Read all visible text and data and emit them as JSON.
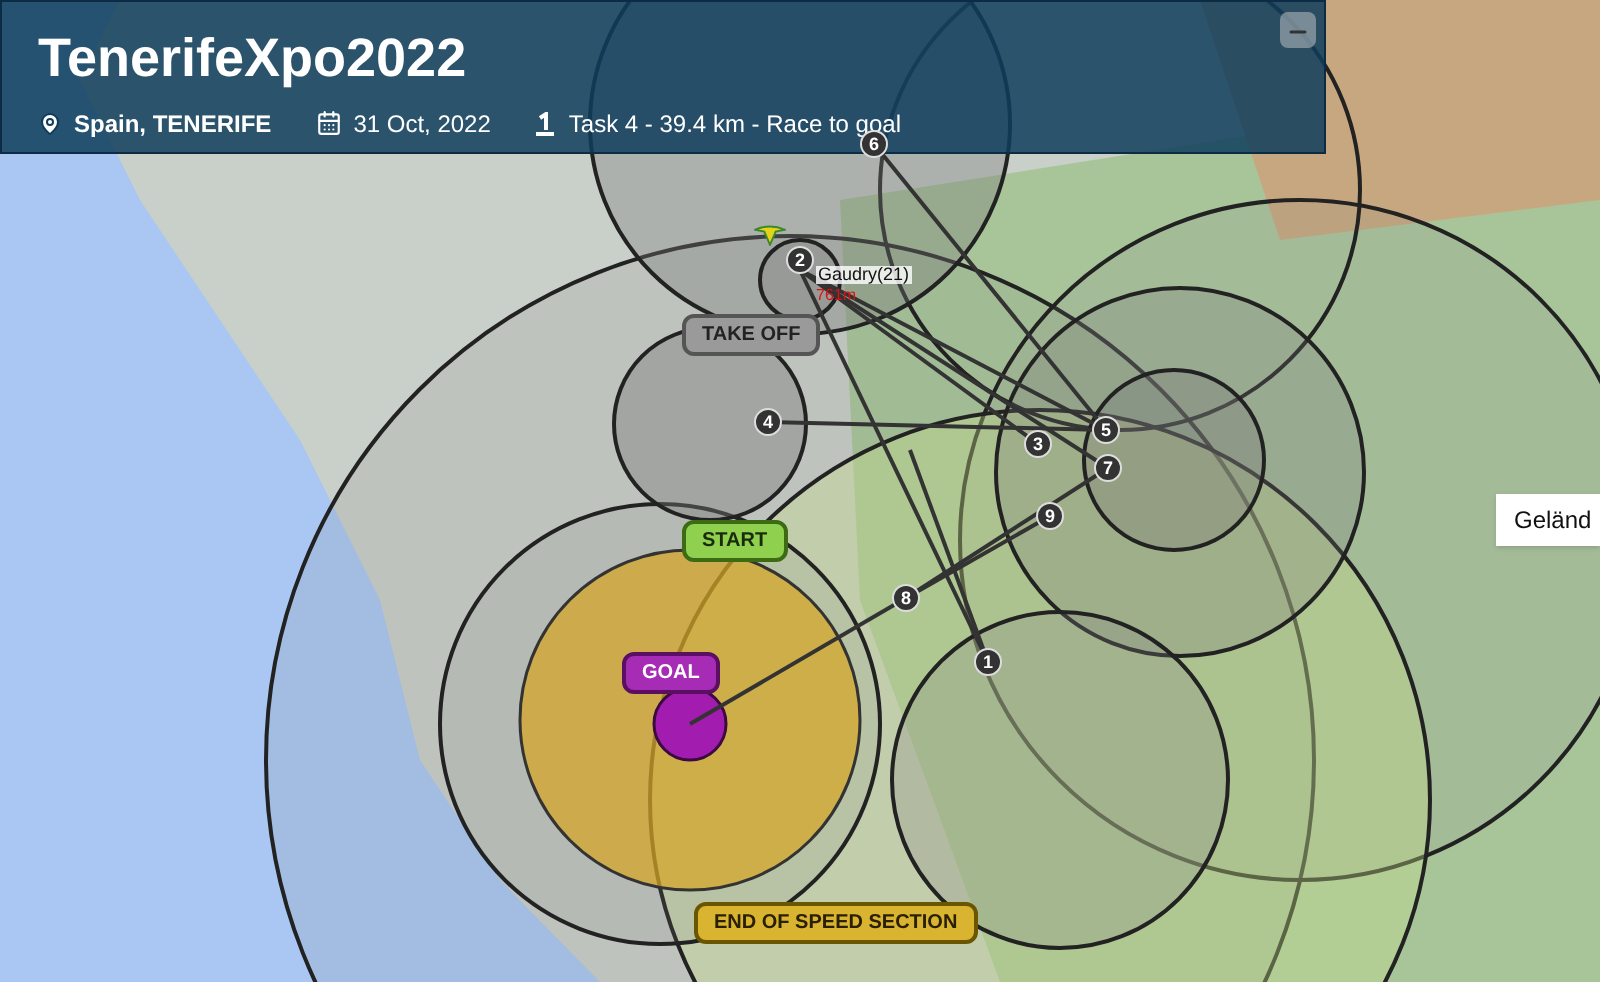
{
  "header": {
    "title": "TenerifeXpo2022",
    "location": "Spain, TENERIFE",
    "date": "31 Oct, 2022",
    "task": "Task 4 - 39.4 km - Race to goal"
  },
  "task_labels": [
    {
      "kind": "takeoff",
      "text": "TAKE OFF"
    },
    {
      "kind": "start",
      "text": "START"
    },
    {
      "kind": "goal",
      "text": "GOAL"
    },
    {
      "kind": "ess",
      "text": "END OF SPEED SECTION"
    }
  ],
  "waypoints": [
    "1",
    "2",
    "3",
    "4",
    "5",
    "6",
    "7",
    "8",
    "9"
  ],
  "pilot": {
    "name": "Gaudry(21)",
    "altitude": "761m"
  },
  "map_type_button": "Geländ"
}
